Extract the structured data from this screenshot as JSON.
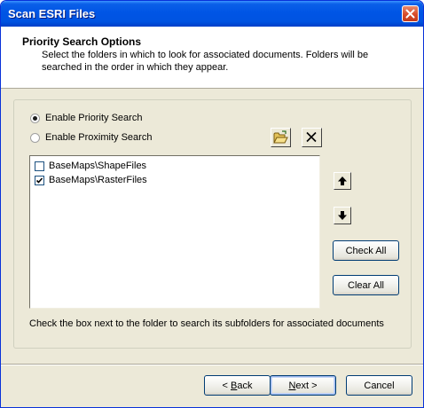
{
  "window": {
    "title": "Scan ESRI Files"
  },
  "header": {
    "title": "Priority Search Options",
    "description": "Select the folders in which to look for associated documents.  Folders will be searched in the order in which they appear."
  },
  "options": {
    "priority_label": "Enable Priority Search",
    "priority_checked": true,
    "proximity_label": "Enable Proximity Search",
    "proximity_checked": false
  },
  "toolbar": {
    "browse_icon": "folder-open-icon",
    "remove_icon": "close-x-icon"
  },
  "folders": [
    {
      "path": "BaseMaps\\ShapeFiles",
      "checked": false
    },
    {
      "path": "BaseMaps\\RasterFiles",
      "checked": true
    }
  ],
  "side_buttons": {
    "move_up_icon": "arrow-up-icon",
    "move_down_icon": "arrow-down-icon",
    "check_all": "Check All",
    "clear_all": "Clear All"
  },
  "hint": "Check the box next to the folder to search its subfolders for associated documents",
  "footer": {
    "back_prefix": "< ",
    "back_key": "B",
    "back_rest": "ack",
    "next_key": "N",
    "next_rest": "ext >",
    "cancel": "Cancel"
  },
  "colors": {
    "titlebar": "#0055e5",
    "dialog_bg": "#ece9d8",
    "button_border": "#003c74"
  }
}
